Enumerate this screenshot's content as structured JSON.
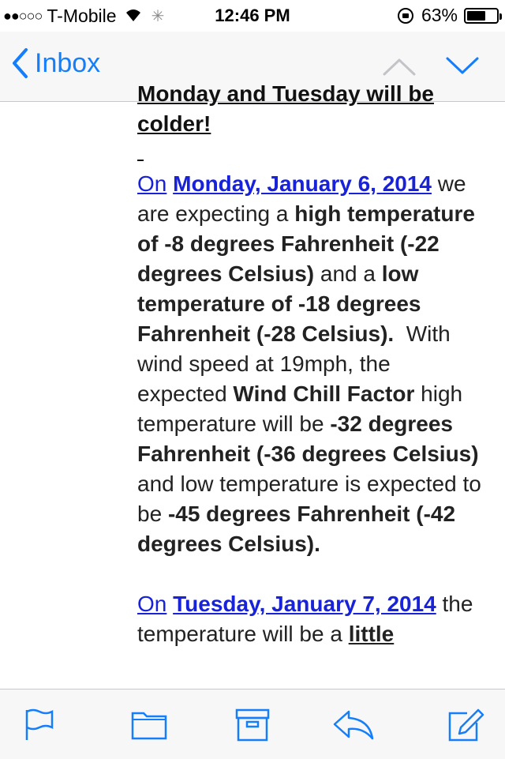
{
  "status_bar": {
    "carrier": "T-Mobile",
    "time": "12:46 PM",
    "battery": "63%",
    "battery_level": 0.63
  },
  "nav": {
    "back_label": "Inbox"
  },
  "email": {
    "heading_line1": "Monday and Tuesday will be",
    "heading_line2": "colder!",
    "para1": {
      "on": "On",
      "date": "Monday, January 6, 2014",
      "t1": "we are expecting a",
      "b1": "high temperature of -8 degrees Fahrenheit (-22 degrees Celsius)",
      "t2": "and a",
      "b2": "low temperature of -18 degrees Fahrenheit (-28 Celsius).",
      "t3": "With wind speed at 19mph, the expected",
      "b3": "Wind Chill Factor",
      "t4": "high temperature will be",
      "b4": "-32 degrees Fahrenheit (-36 degrees Celsius)",
      "t5": "and low temperature is expected to be",
      "b5": "-45 degrees Fahrenheit (-42 degrees Celsius)."
    },
    "para2": {
      "on": "On",
      "date": "Tuesday, January 7, 2014",
      "t1": "the temperature will be a",
      "b1": "little"
    }
  }
}
